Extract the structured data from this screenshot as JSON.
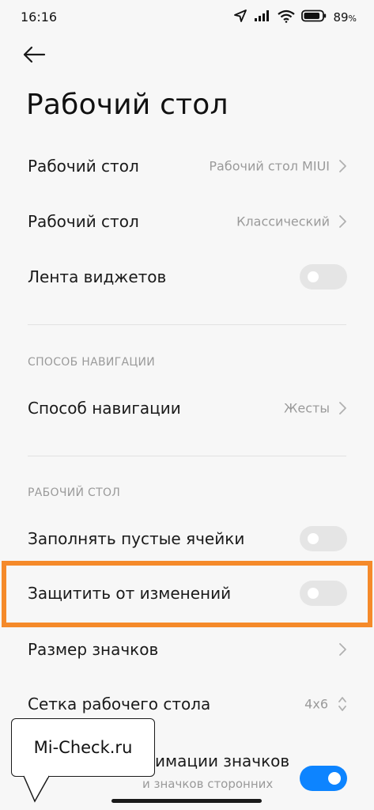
{
  "status_bar": {
    "time": "16:16",
    "battery_percent": "89",
    "battery_suffix": "%",
    "icons": [
      "location-arrow-icon",
      "signal-icon",
      "wifi-icon",
      "battery-icon"
    ]
  },
  "header": {
    "back_icon": "arrow-left-icon",
    "title": "Рабочий стол"
  },
  "rows_top": [
    {
      "label": "Рабочий стол",
      "value": "Рабочий стол MIUI",
      "control": "chevron"
    },
    {
      "label": "Рабочий стол",
      "value": "Классический",
      "control": "chevron"
    },
    {
      "label": "Лента виджетов",
      "control": "toggle",
      "on": false
    }
  ],
  "section_navigation": {
    "header": "СПОСОБ НАВИГАЦИИ",
    "rows": [
      {
        "label": "Способ навигации",
        "value": "Жесты",
        "control": "chevron"
      }
    ]
  },
  "section_desktop": {
    "header": "РАБОЧИЙ СТОЛ",
    "rows": [
      {
        "label": "Заполнять пустые ячейки",
        "control": "toggle",
        "on": false
      },
      {
        "label": "Защитить от изменений",
        "control": "toggle",
        "on": false,
        "highlighted": true
      },
      {
        "label": "Размер значков",
        "control": "chevron"
      },
      {
        "label": "Сетка рабочего стола",
        "value": "4x6",
        "control": "up-down"
      },
      {
        "label": "имации значков",
        "sublabel": "и значков сторонних",
        "control": "toggle",
        "on": true
      }
    ]
  },
  "watermark": {
    "text": "Mi-Check.ru"
  },
  "colors": {
    "accent": "#0d84ff",
    "highlight_border": "#f58a2a",
    "toggle_off": "#e5e5e5",
    "secondary_text": "#9a9a9a",
    "background": "#f7f7f7"
  }
}
